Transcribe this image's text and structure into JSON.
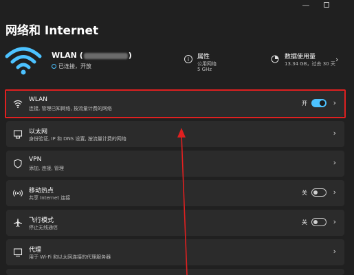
{
  "window": {
    "minimize_glyph": "—"
  },
  "page": {
    "title": "网络和 Internet"
  },
  "connection": {
    "name_prefix": "WLAN (",
    "name_suffix": ")",
    "status": "已连接，开放"
  },
  "properties": {
    "title": "属性",
    "line1": "公用网络",
    "line2": "5 GHz"
  },
  "data_usage": {
    "title": "数据使用量",
    "detail": "13.34 GB，过去 30 天"
  },
  "items": [
    {
      "title": "WLAN",
      "subtitle": "连接, 管理已知网络, 按流量计费的网络",
      "toggle_label": "开",
      "toggle_on": true,
      "icon": "wifi-icon"
    },
    {
      "title": "以太网",
      "subtitle": "身份验证, IP 和 DNS 设置, 按流量计费的网络",
      "icon": "ethernet-icon"
    },
    {
      "title": "VPN",
      "subtitle": "添加, 连接, 管理",
      "icon": "shield-icon"
    },
    {
      "title": "移动热点",
      "subtitle": "共享 Internet 连接",
      "toggle_label": "关",
      "toggle_on": false,
      "icon": "hotspot-icon"
    },
    {
      "title": "飞行模式",
      "subtitle": "停止无线通信",
      "toggle_label": "关",
      "toggle_on": false,
      "icon": "airplane-icon"
    },
    {
      "title": "代理",
      "subtitle": "用于 Wi-Fi 和以太网连接的代理服务器",
      "icon": "proxy-icon"
    }
  ],
  "colors": {
    "accent": "#4cc2ff",
    "highlight": "#e02020",
    "background": "#202020",
    "card": "#2b2b2b"
  }
}
